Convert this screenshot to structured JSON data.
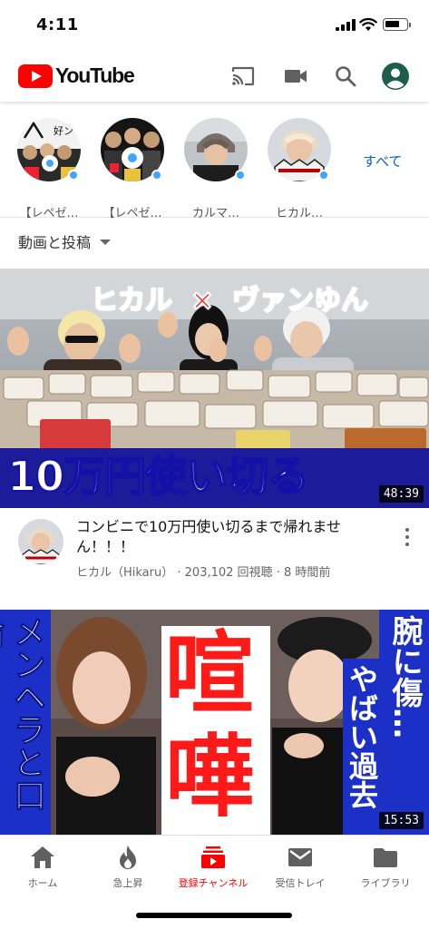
{
  "status_bar": {
    "time": "4:11",
    "battery_level": 0.7
  },
  "app_bar": {
    "logo_text": "YouTube",
    "icons": [
      "cast-icon",
      "camera-icon",
      "search-icon",
      "account-icon"
    ]
  },
  "channels": {
    "items": [
      {
        "name": "【レペゼ…",
        "has_new": true
      },
      {
        "name": "【レペゼ…",
        "has_new": true
      },
      {
        "name": "カルマ…",
        "has_new": true
      },
      {
        "name": "ヒカル…",
        "has_new": true
      }
    ],
    "see_all": "すべて"
  },
  "filter": {
    "label": "動画と投稿"
  },
  "videos": [
    {
      "thumb_text_top_1": "ヒカル",
      "thumb_text_top_x": "×",
      "thumb_text_top_2": "ヴァンゆん",
      "thumb_text_bottom": "10万円使い切る",
      "duration": "48:39",
      "title": "コンビニで10万円使い切るまで帰れません！！！",
      "channel": "ヒカル（Hikaru）",
      "views": "203,102 回視聴",
      "age": "8 時間前"
    },
    {
      "thumb_text_left": "メンヘラと口論",
      "thumb_text_center_1": "喧",
      "thumb_text_center_2": "嘩",
      "thumb_text_right_1": "腕に傷…",
      "thumb_text_right_2": "やばい過去",
      "duration": "15:53"
    }
  ],
  "bottom_nav": {
    "items": [
      {
        "label": "ホーム",
        "icon": "home-icon",
        "active": false
      },
      {
        "label": "急上昇",
        "icon": "trending-icon",
        "active": false
      },
      {
        "label": "登録チャンネル",
        "icon": "subscriptions-icon",
        "active": true
      },
      {
        "label": "受信トレイ",
        "icon": "inbox-icon",
        "active": false
      },
      {
        "label": "ライブラリ",
        "icon": "library-icon",
        "active": false
      }
    ]
  },
  "colors": {
    "brand": "#ff0000",
    "link": "#065fd4",
    "new_dot": "#3ea6ff"
  }
}
